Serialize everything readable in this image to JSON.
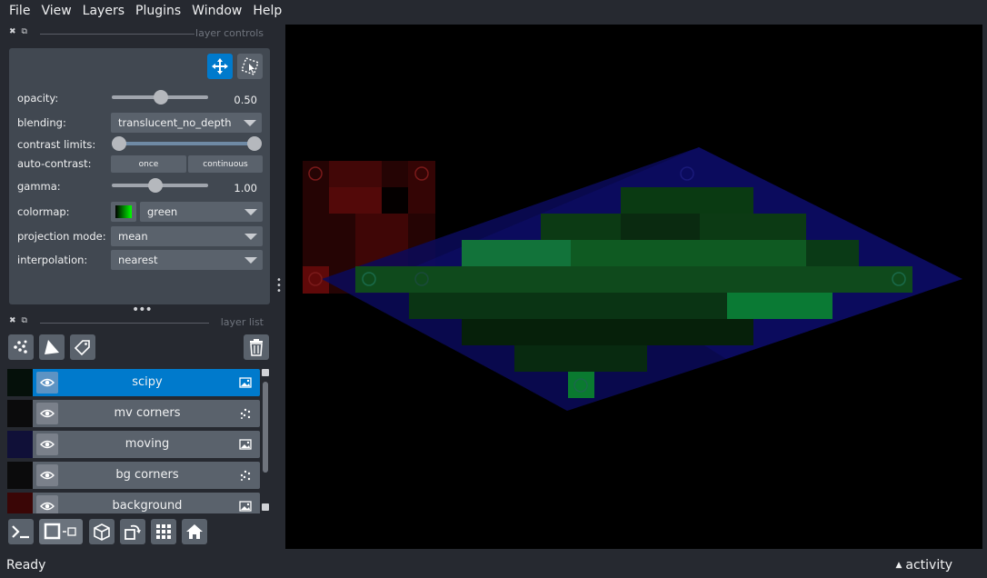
{
  "menu": [
    "File",
    "View",
    "Layers",
    "Plugins",
    "Window",
    "Help"
  ],
  "layer_controls": {
    "title": "layer controls",
    "opacity_label": "opacity:",
    "opacity_value": "0.50",
    "opacity_fraction": 0.5,
    "blending_label": "blending:",
    "blending_value": "translucent_no_depth",
    "contrast_label": "contrast limits:",
    "auto_contrast_label": "auto-contrast:",
    "once_label": "once",
    "continuous_label": "continuous",
    "gamma_label": "gamma:",
    "gamma_value": "1.00",
    "colormap_label": "colormap:",
    "colormap_value": "green",
    "projection_label": "projection mode:",
    "projection_value": "mean",
    "interpolation_label": "interpolation:",
    "interpolation_value": "nearest"
  },
  "layer_list": {
    "title": "layer list",
    "layers": [
      {
        "name": "scipy",
        "type_icon": "image-icon",
        "selected": true
      },
      {
        "name": "mv corners",
        "type_icon": "points-icon",
        "selected": false
      },
      {
        "name": "moving",
        "type_icon": "image-icon",
        "selected": false
      },
      {
        "name": "bg corners",
        "type_icon": "points-icon",
        "selected": false
      },
      {
        "name": "background",
        "type_icon": "image-icon",
        "selected": false
      }
    ]
  },
  "status": {
    "text": "Ready",
    "activity_label": "activity"
  },
  "colors": {
    "accent": "#007acc",
    "panel": "#414851",
    "background": "#262930"
  }
}
